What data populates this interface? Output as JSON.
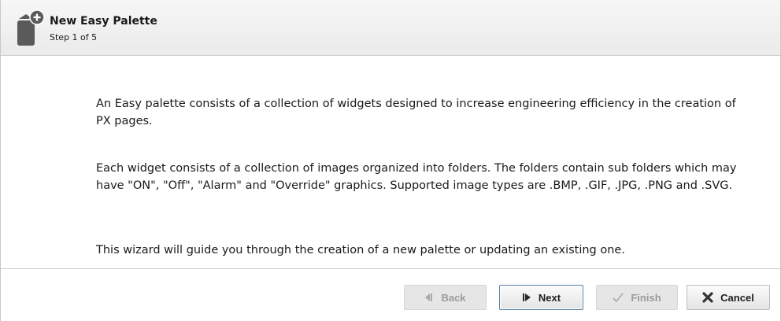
{
  "header": {
    "title": "New Easy Palette",
    "step": "Step 1 of 5",
    "icon": "new-palette-icon"
  },
  "content": {
    "paragraphs": [
      "An Easy palette consists of a collection of widgets designed to increase engineering efficiency in the creation of PX pages.",
      "Each widget consists of a collection of images organized into folders. The folders contain sub folders which may have \"ON\", \"Off\", \"Alarm\" and \"Override\" graphics. Supported image types are .BMP, .GIF, .JPG, .PNG and .SVG.",
      "This wizard will guide you through the creation of a new palette or updating an existing one."
    ]
  },
  "buttons": {
    "back": {
      "label": "Back",
      "icon": "back-arrow-icon",
      "enabled": false
    },
    "next": {
      "label": "Next",
      "icon": "next-arrow-icon",
      "enabled": true,
      "focused": true
    },
    "finish": {
      "label": "Finish",
      "icon": "checkmark-icon",
      "enabled": false
    },
    "cancel": {
      "label": "Cancel",
      "icon": "cancel-x-icon",
      "enabled": true
    }
  },
  "colors": {
    "header_bg": "#efefef",
    "disabled_text": "#9b9b9b",
    "cancel_icon": "#333333",
    "focus_border": "#5b7fa8"
  }
}
